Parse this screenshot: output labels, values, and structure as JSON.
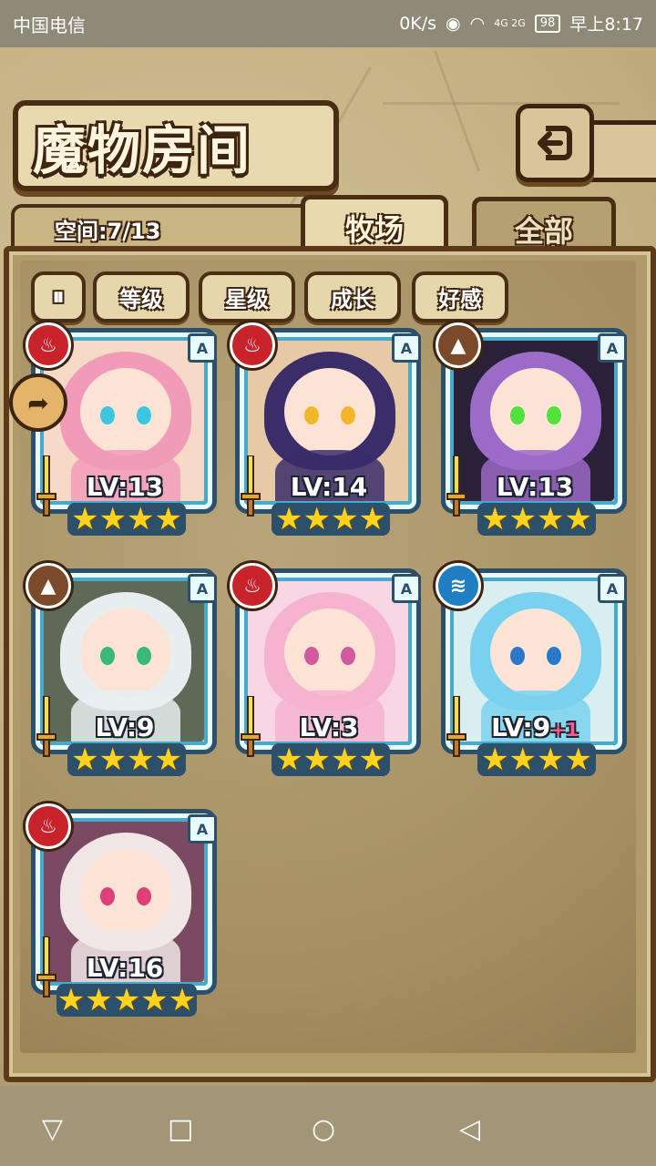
{
  "status_bar": {
    "carrier": "中国电信",
    "speed": "0K/s",
    "network": "4G 2G",
    "battery": "98",
    "time": "早上8:17"
  },
  "header": {
    "title": "魔物房间",
    "back_icon": "back-arrow-icon"
  },
  "space": {
    "label": "空间:7/13"
  },
  "tabs": [
    {
      "label": "牧场",
      "active": true
    },
    {
      "label": "全部",
      "active": false
    }
  ],
  "filters": [
    {
      "label": "等级"
    },
    {
      "label": "星级"
    },
    {
      "label": "成长"
    },
    {
      "label": "好感"
    }
  ],
  "monsters": [
    {
      "element": "fire",
      "element_color": "#c8232a",
      "rank": "A",
      "level": "LV:13",
      "plus": "",
      "stars": "★★★★",
      "hair_color": "#f29bb8",
      "eye_color": "#3ec6e0",
      "bg_color": "#f7d9c8"
    },
    {
      "element": "fire",
      "element_color": "#c8232a",
      "rank": "A",
      "level": "LV:14",
      "plus": "",
      "stars": "★★★★",
      "hair_color": "#3a2d6a",
      "eye_color": "#f2b72b",
      "bg_color": "#e8c9a6"
    },
    {
      "element": "earth",
      "element_color": "#7a4a2a",
      "rank": "A",
      "level": "LV:13",
      "plus": "",
      "stars": "★★★★",
      "hair_color": "#9b6bc7",
      "eye_color": "#53e03a",
      "bg_color": "#2a2038"
    },
    {
      "element": "earth",
      "element_color": "#7a4a2a",
      "rank": "A",
      "level": "LV:9",
      "plus": "",
      "stars": "★★★★",
      "hair_color": "#e8eef0",
      "eye_color": "#3ab87a",
      "bg_color": "#5e6a58"
    },
    {
      "element": "fire",
      "element_color": "#c8232a",
      "rank": "A",
      "level": "LV:3",
      "plus": "",
      "stars": "★★★★",
      "hair_color": "#f6b3cf",
      "eye_color": "#d45aa0",
      "bg_color": "#f8d6e4"
    },
    {
      "element": "water",
      "element_color": "#1f7fc2",
      "rank": "A",
      "level": "LV:9",
      "plus": "+1",
      "stars": "★★★★",
      "hair_color": "#7ad1ef",
      "eye_color": "#2a78c8",
      "bg_color": "#d9eef0"
    },
    {
      "element": "fire",
      "element_color": "#c8232a",
      "rank": "A",
      "level": "LV:16",
      "plus": "",
      "stars": "★★★★★",
      "hair_color": "#f1e6e6",
      "eye_color": "#e0407a",
      "bg_color": "#7a4a62"
    }
  ],
  "navigation": {
    "back": "▽",
    "home": "○",
    "recent": "□",
    "prev": "◁"
  }
}
